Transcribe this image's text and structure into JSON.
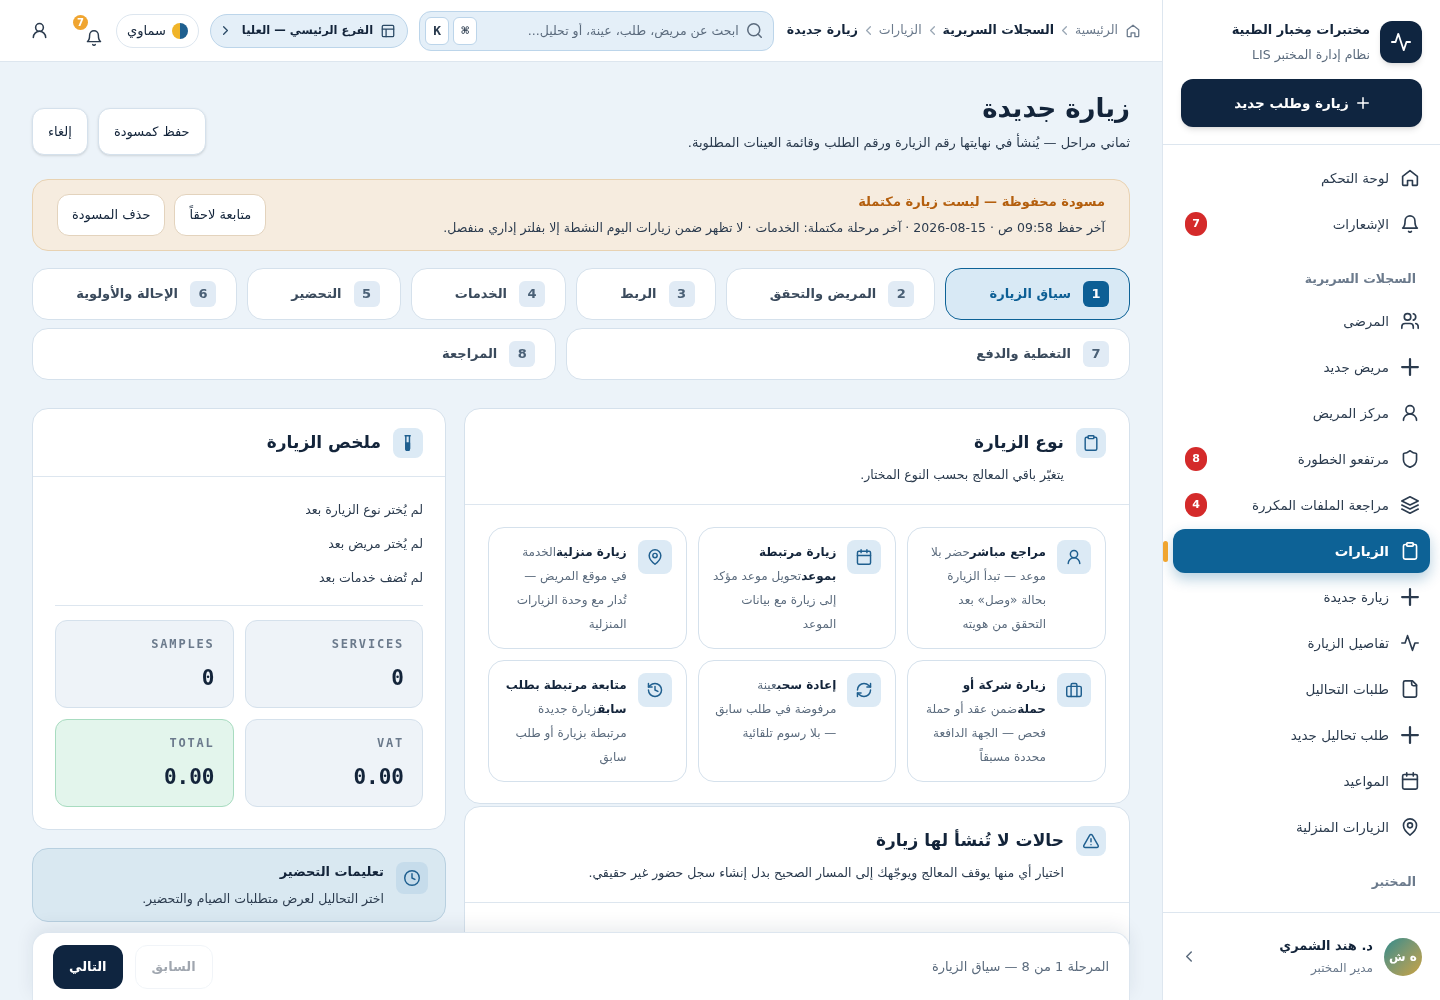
{
  "sidebar": {
    "brand": {
      "name": "مختبرات مِخبار الطبية",
      "subtitle": "نظام إدارة المختبر LIS"
    },
    "new_button": {
      "label": "زيارة وطلب جديد"
    },
    "sections": [
      {
        "items": [
          {
            "label": "لوحة التحكم",
            "selected": false
          },
          {
            "label": "الإشعارات",
            "badge": "7",
            "selected": false
          }
        ]
      },
      {
        "title": "السجلات السريرية",
        "items": [
          {
            "label": "المرضى",
            "selected": false
          },
          {
            "label": "مريض جديد",
            "selected": false
          },
          {
            "label": "مركز المريض",
            "selected": false
          },
          {
            "label": "مرتفعو الخطورة",
            "badge": "8",
            "selected": false
          },
          {
            "label": "مراجعة الملفات المكررة",
            "badge": "4",
            "selected": false
          },
          {
            "label": "الزيارات",
            "selected": true
          },
          {
            "label": "زيارة جديدة",
            "selected": false
          },
          {
            "label": "تفاصيل الزيارة",
            "selected": false
          },
          {
            "label": "طلبات التحاليل",
            "selected": false
          },
          {
            "label": "طلب تحاليل جديد",
            "selected": false
          },
          {
            "label": "المواعيد",
            "selected": false
          },
          {
            "label": "الزيارات المنزلية",
            "selected": false
          }
        ]
      },
      {
        "title": "المختبر"
      }
    ],
    "user": {
      "name": "د. هند الشمري",
      "role": "مدير المختبر",
      "initials": "ه ش"
    }
  },
  "header": {
    "breadcrumbs": [
      {
        "label": "الرئيسية",
        "emphasized": false
      },
      {
        "label": "السجلات السريرية",
        "emphasized": true
      },
      {
        "label": "الزيارات",
        "emphasized": false
      },
      {
        "label": "زيارة جديدة",
        "emphasized": true
      }
    ],
    "search": {
      "placeholder": "ابحث عن مريض، طلب، عينة، أو تحليل...",
      "shortcut": [
        "⌘",
        "K"
      ]
    },
    "branch": {
      "label": "الفرع الرئيسي — العليا"
    },
    "theme": {
      "label": "سماوي"
    },
    "notifications": {
      "badge": "7"
    }
  },
  "page": {
    "title": "زيارة جديدة",
    "subtitle": "ثماني مراحل — يُنشأ في نهايتها رقم الزيارة ورقم الطلب وقائمة العينات المطلوبة.",
    "actions": [
      {
        "label": "حفظ كمسودة"
      },
      {
        "label": "إلغاء"
      }
    ]
  },
  "draft_notice": {
    "title": "مسودة محفوظة — ليست زيارة مكتملة",
    "text": "آخر حفظ 09:58 ص · 15-08-2026 · آخر مرحلة مكتملة: الخدمات · لا تظهر ضمن زيارات اليوم النشطة إلا بفلتر إداري منفصل.",
    "actions": [
      {
        "label": "متابعة لاحقاً"
      },
      {
        "label": "حذف المسودة"
      }
    ]
  },
  "steps": [
    {
      "number": "1",
      "label": "سياق الزيارة",
      "selected": true
    },
    {
      "number": "2",
      "label": "المريض والتحقق",
      "selected": false
    },
    {
      "number": "3",
      "label": "الربط",
      "selected": false
    },
    {
      "number": "4",
      "label": "الخدمات",
      "selected": false
    },
    {
      "number": "5",
      "label": "التحضير",
      "selected": false
    },
    {
      "number": "6",
      "label": "الإحالة والأولوية",
      "selected": false
    },
    {
      "number": "7",
      "label": "التغطية والدفع",
      "selected": false
    },
    {
      "number": "8",
      "label": "المراجعة",
      "selected": false
    }
  ],
  "visit_type": {
    "title": "نوع الزيارة",
    "subtitle": "يتغيّر باقي المعالج بحسب النوع المختار.",
    "options": [
      {
        "title": "مراجع مباشر",
        "description": "حضر بلا موعد — تبدأ الزيارة بحالة «وصل» بعد التحقق من هويته",
        "selected": false
      },
      {
        "title": "زيارة مرتبطة بموعد",
        "description": "تحويل موعد مؤكد إلى زيارة مع بيانات الموعد",
        "selected": false
      },
      {
        "title": "زيارة منزلية",
        "description": "الخدمة في موقع المريض — تُدار مع وحدة الزيارات المنزلية",
        "selected": false
      },
      {
        "title": "زيارة شركة أو حملة",
        "description": "ضمن عقد أو حملة فحص — الجهة الدافعة محددة مسبقاً",
        "selected": false
      },
      {
        "title": "إعادة سحب",
        "description": "عينة مرفوضة في طلب سابق — بلا رسوم تلقائية",
        "selected": false
      },
      {
        "title": "متابعة مرتبطة بطلب سابق",
        "description": "زيارة جديدة مرتبطة بزيارة أو طلب سابق",
        "selected": false
      }
    ]
  },
  "exclusions": {
    "title": "حالات لا تُنشأ لها زيارة",
    "subtitle": "اختيار أي منها يوقف المعالج ويوجّهك إلى المسار الصحيح بدل إنشاء سجل حضور غير حقيقي."
  },
  "summary": {
    "title": "ملخص الزيارة",
    "lines": [
      "لم يُختر نوع الزيارة بعد",
      "لم يُختر مريض بعد",
      "لم تُضف خدمات بعد"
    ],
    "stats": [
      {
        "label": "SERVICES",
        "value": "0",
        "highlighted": false
      },
      {
        "label": "SAMPLES",
        "value": "0",
        "highlighted": false
      },
      {
        "label": "VAT",
        "value": "0.00",
        "highlighted": false
      },
      {
        "label": "TOTAL",
        "value": "0.00",
        "highlighted": true
      }
    ]
  },
  "prep": {
    "title": "تعليمات التحضير",
    "text": "اختر التحاليل لعرض متطلبات الصيام والتحضير."
  },
  "footer": {
    "caption": "المرحلة 1 من 8 — سياق الزيارة",
    "buttons": [
      {
        "label": "السابق",
        "kind": "secondary",
        "disabled": true
      },
      {
        "label": "التالي",
        "kind": "primary",
        "disabled": false
      }
    ]
  }
}
